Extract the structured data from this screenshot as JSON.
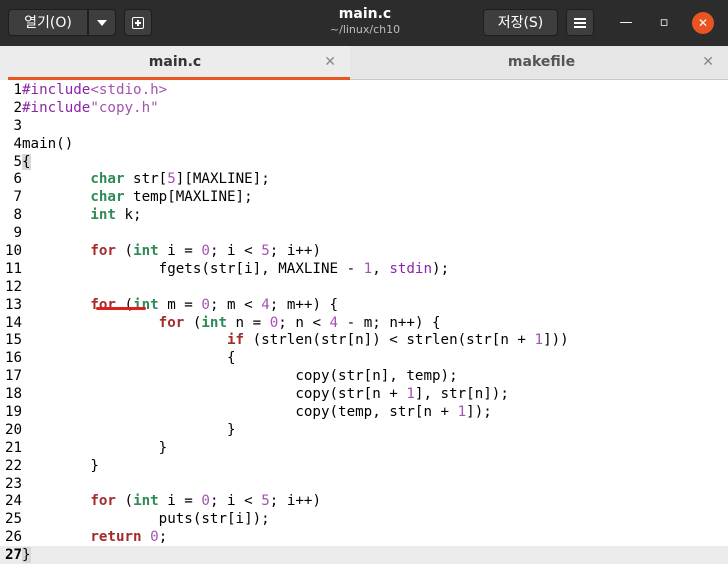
{
  "header": {
    "open_label": "열기(O)",
    "save_label": "저장(S)",
    "title": "main.c",
    "subtitle": "~/linux/ch10",
    "minimize_glyph": "—",
    "maximize_glyph": "▫",
    "close_glyph": "✕"
  },
  "tabs": [
    {
      "label": "main.c",
      "active": true,
      "close": "✕"
    },
    {
      "label": "makefile",
      "active": false,
      "close": "✕"
    }
  ],
  "accent_color": "#e95420",
  "editor": {
    "current_line": 27,
    "lines": [
      {
        "num": "1",
        "segments": [
          {
            "t": "#include",
            "c": "pp"
          },
          {
            "t": "<stdio.h>",
            "c": "st"
          }
        ]
      },
      {
        "num": "2",
        "segments": [
          {
            "t": "#include",
            "c": "pp"
          },
          {
            "t": "\"copy.h\"",
            "c": "st"
          }
        ]
      },
      {
        "num": "3",
        "segments": []
      },
      {
        "num": "4",
        "segments": [
          {
            "t": "main()",
            "c": ""
          }
        ]
      },
      {
        "num": "5",
        "segments": [
          {
            "t": "{",
            "c": "brace-hl"
          }
        ]
      },
      {
        "num": "6",
        "segments": [
          {
            "t": "        ",
            "c": ""
          },
          {
            "t": "char",
            "c": "ty"
          },
          {
            "t": " str[",
            "c": ""
          },
          {
            "t": "5",
            "c": "nu"
          },
          {
            "t": "][MAXLINE];",
            "c": ""
          }
        ]
      },
      {
        "num": "7",
        "segments": [
          {
            "t": "        ",
            "c": ""
          },
          {
            "t": "char",
            "c": "ty"
          },
          {
            "t": " temp[MAXLINE];",
            "c": ""
          }
        ]
      },
      {
        "num": "8",
        "segments": [
          {
            "t": "        ",
            "c": ""
          },
          {
            "t": "int",
            "c": "ty"
          },
          {
            "t": " k;",
            "c": ""
          }
        ]
      },
      {
        "num": "9",
        "segments": []
      },
      {
        "num": "10",
        "segments": [
          {
            "t": "        ",
            "c": ""
          },
          {
            "t": "for",
            "c": "kw"
          },
          {
            "t": " (",
            "c": ""
          },
          {
            "t": "int",
            "c": "ty"
          },
          {
            "t": " i = ",
            "c": ""
          },
          {
            "t": "0",
            "c": "nu"
          },
          {
            "t": "; i < ",
            "c": ""
          },
          {
            "t": "5",
            "c": "nu"
          },
          {
            "t": "; i++)",
            "c": ""
          }
        ]
      },
      {
        "num": "11",
        "segments": [
          {
            "t": "                fgets(str[i], MAXLINE - ",
            "c": ""
          },
          {
            "t": "1",
            "c": "nu"
          },
          {
            "t": ", ",
            "c": ""
          },
          {
            "t": "stdin",
            "c": "pp"
          },
          {
            "t": ");",
            "c": ""
          }
        ]
      },
      {
        "num": "12",
        "segments": []
      },
      {
        "num": "13",
        "segments": [
          {
            "t": "        ",
            "c": ""
          },
          {
            "t": "for",
            "c": "kw"
          },
          {
            "t": " (",
            "c": ""
          },
          {
            "t": "int",
            "c": "ty"
          },
          {
            "t": " m = ",
            "c": ""
          },
          {
            "t": "0",
            "c": "nu"
          },
          {
            "t": "; m < ",
            "c": ""
          },
          {
            "t": "4",
            "c": "nu"
          },
          {
            "t": "; m++) {",
            "c": ""
          }
        ]
      },
      {
        "num": "14",
        "segments": [
          {
            "t": "                ",
            "c": ""
          },
          {
            "t": "for",
            "c": "kw"
          },
          {
            "t": " (",
            "c": ""
          },
          {
            "t": "int",
            "c": "ty"
          },
          {
            "t": " n = ",
            "c": ""
          },
          {
            "t": "0",
            "c": "nu"
          },
          {
            "t": "; n < ",
            "c": ""
          },
          {
            "t": "4",
            "c": "nu"
          },
          {
            "t": " - m; n++) {",
            "c": ""
          }
        ]
      },
      {
        "num": "15",
        "segments": [
          {
            "t": "                        ",
            "c": ""
          },
          {
            "t": "if",
            "c": "kw"
          },
          {
            "t": " (strlen(str[n]) < strlen(str[n + ",
            "c": ""
          },
          {
            "t": "1",
            "c": "nu"
          },
          {
            "t": "]))",
            "c": ""
          }
        ]
      },
      {
        "num": "16",
        "segments": [
          {
            "t": "                        {",
            "c": ""
          }
        ]
      },
      {
        "num": "17",
        "segments": [
          {
            "t": "                                copy(str[n], temp);",
            "c": ""
          }
        ]
      },
      {
        "num": "18",
        "segments": [
          {
            "t": "                                copy(str[n + ",
            "c": ""
          },
          {
            "t": "1",
            "c": "nu"
          },
          {
            "t": "], str[n]);",
            "c": ""
          }
        ]
      },
      {
        "num": "19",
        "segments": [
          {
            "t": "                                copy(temp, str[n + ",
            "c": ""
          },
          {
            "t": "1",
            "c": "nu"
          },
          {
            "t": "]);",
            "c": ""
          }
        ]
      },
      {
        "num": "20",
        "segments": [
          {
            "t": "                        }",
            "c": ""
          }
        ]
      },
      {
        "num": "21",
        "segments": [
          {
            "t": "                }",
            "c": ""
          }
        ]
      },
      {
        "num": "22",
        "segments": [
          {
            "t": "        }",
            "c": ""
          }
        ]
      },
      {
        "num": "23",
        "segments": []
      },
      {
        "num": "24",
        "segments": [
          {
            "t": "        ",
            "c": ""
          },
          {
            "t": "for",
            "c": "kw"
          },
          {
            "t": " (",
            "c": ""
          },
          {
            "t": "int",
            "c": "ty"
          },
          {
            "t": " i = ",
            "c": ""
          },
          {
            "t": "0",
            "c": "nu"
          },
          {
            "t": "; i < ",
            "c": ""
          },
          {
            "t": "5",
            "c": "nu"
          },
          {
            "t": "; i++)",
            "c": ""
          }
        ]
      },
      {
        "num": "25",
        "segments": [
          {
            "t": "                puts(str[i]);",
            "c": ""
          }
        ]
      },
      {
        "num": "26",
        "segments": [
          {
            "t": "        ",
            "c": ""
          },
          {
            "t": "return",
            "c": "kw"
          },
          {
            "t": " ",
            "c": ""
          },
          {
            "t": "0",
            "c": "nu"
          },
          {
            "t": ";",
            "c": ""
          }
        ]
      },
      {
        "num": "27",
        "segments": [
          {
            "t": "}",
            "c": "brace-hl"
          }
        ]
      }
    ]
  }
}
